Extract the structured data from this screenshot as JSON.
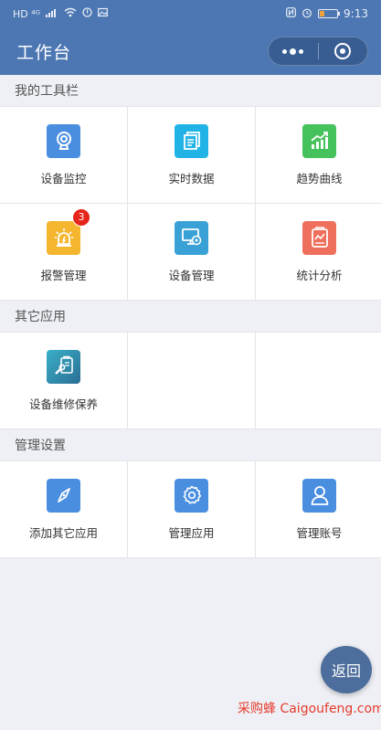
{
  "status_bar": {
    "left_indicators": "HD ⁴ᴳ",
    "time": "9:13"
  },
  "header": {
    "title": "工作台"
  },
  "sections": [
    {
      "title": "我的工具栏",
      "items": [
        {
          "label": "设备监控",
          "icon": "camera-icon",
          "color": "#4a8ee0"
        },
        {
          "label": "实时数据",
          "icon": "data-stack-icon",
          "color": "#22b3e6"
        },
        {
          "label": "趋势曲线",
          "icon": "trend-chart-icon",
          "color": "#45c25c"
        },
        {
          "label": "报警管理",
          "icon": "alarm-light-icon",
          "color": "#f4b62f",
          "badge": "3"
        },
        {
          "label": "设备管理",
          "icon": "monitor-gear-icon",
          "color": "#3aa1d6"
        },
        {
          "label": "统计分析",
          "icon": "report-icon",
          "color": "#ee6f5b"
        }
      ]
    },
    {
      "title": "其它应用",
      "items": [
        {
          "label": "设备维修保养",
          "icon": "wrench-clipboard-icon",
          "color": "#2f8bb0"
        }
      ]
    },
    {
      "title": "管理设置",
      "items": [
        {
          "label": "添加其它应用",
          "icon": "compass-icon",
          "color": "#4a8ee0"
        },
        {
          "label": "管理应用",
          "icon": "gear-icon",
          "color": "#4a8ee0"
        },
        {
          "label": "管理账号",
          "icon": "user-icon",
          "color": "#4a8ee0"
        }
      ]
    }
  ],
  "back_button": {
    "label": "返回"
  },
  "watermark": "采购蜂 Caigoufeng.com"
}
